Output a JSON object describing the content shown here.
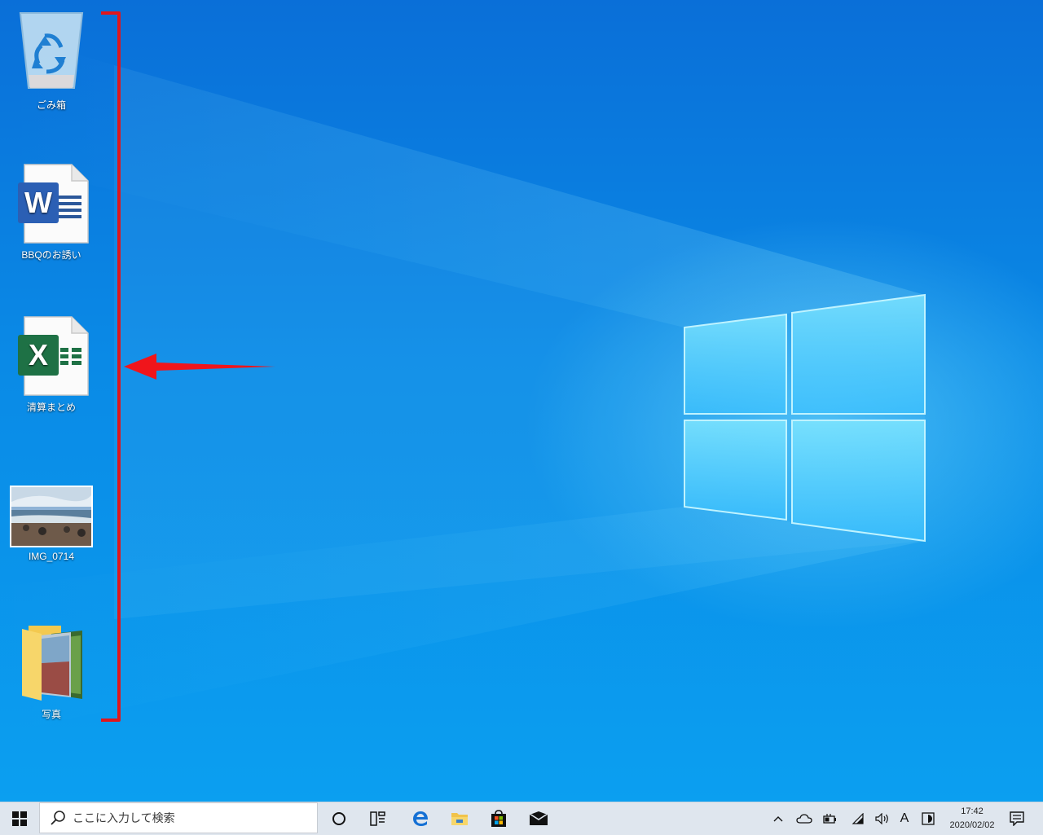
{
  "desktop": {
    "icons": [
      {
        "label": "ごみ箱",
        "icon": "recycle-bin-icon"
      },
      {
        "label": "BBQのお誘い",
        "icon": "word-document-icon"
      },
      {
        "label": "清算まとめ",
        "icon": "excel-workbook-icon"
      },
      {
        "label": "IMG_0714",
        "icon": "photo-thumbnail-icon"
      },
      {
        "label": "写真",
        "icon": "photo-folder-icon"
      }
    ],
    "annotation": {
      "bracket_color": "#e0161c",
      "arrow_color": "#f0151b"
    }
  },
  "taskbar": {
    "search_placeholder": "ここに入力して検索",
    "apps": [
      "cortana-icon",
      "task-view-icon",
      "edge-icon",
      "file-explorer-icon",
      "store-icon",
      "mail-icon"
    ],
    "tray": {
      "ime": "A",
      "time": "17:42",
      "date": "2020/02/02"
    }
  },
  "colors": {
    "accent": "#0a78d7",
    "taskbar": "#dfe6ee"
  }
}
